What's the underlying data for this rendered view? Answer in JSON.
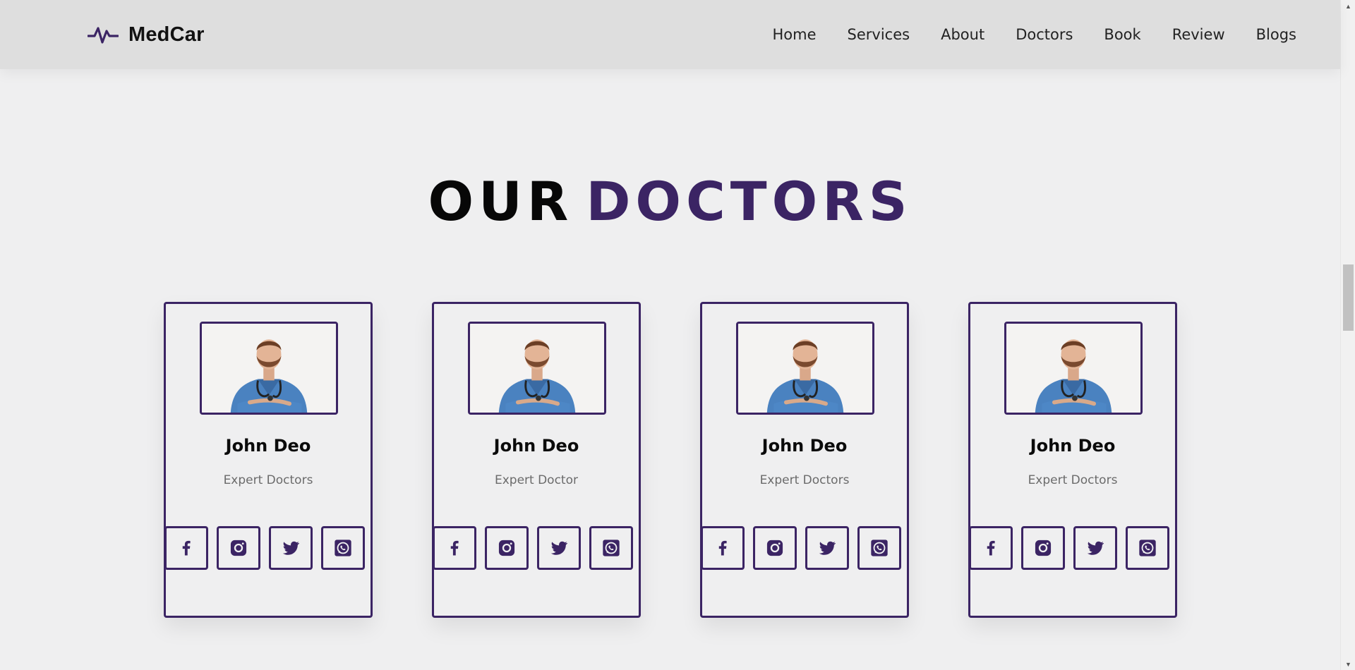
{
  "brand": {
    "name": "MedCar",
    "icon": "pulse-icon"
  },
  "nav": {
    "items": [
      "Home",
      "Services",
      "About",
      "Doctors",
      "Book",
      "Review",
      "Blogs"
    ]
  },
  "section": {
    "title_part1": "OUR",
    "title_part2": "DOCTORS"
  },
  "doctors": [
    {
      "name": "John Deo",
      "role": "Expert Doctors"
    },
    {
      "name": "John Deo",
      "role": "Expert Doctor"
    },
    {
      "name": "John Deo",
      "role": "Expert Doctors"
    },
    {
      "name": "John Deo",
      "role": "Expert Doctors"
    }
  ],
  "social_icons": [
    "facebook-icon",
    "instagram-icon",
    "twitter-icon",
    "whatsapp-icon"
  ],
  "colors": {
    "accent": "#3b2464",
    "header_bg": "#dedede",
    "page_bg": "#efeff0"
  }
}
